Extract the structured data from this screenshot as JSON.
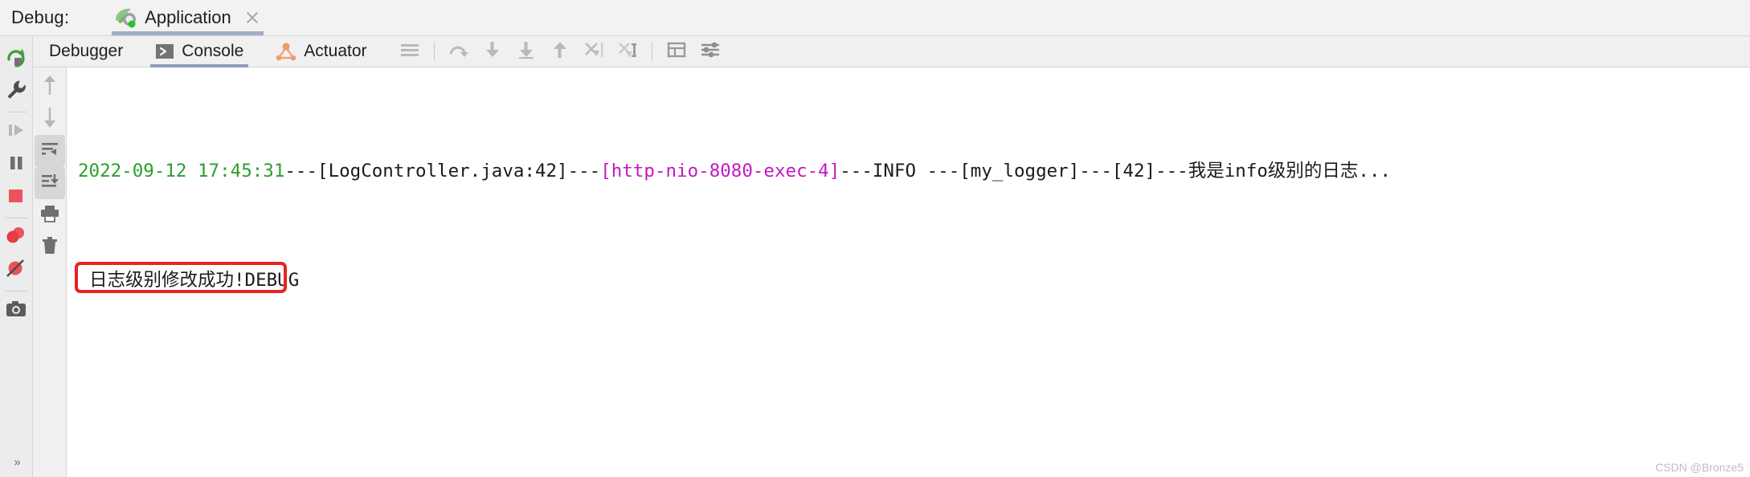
{
  "header": {
    "label": "Debug:",
    "run_tab": {
      "name": "Application",
      "icon": "spring-boot-leaf-icon",
      "close_icon": "close-icon",
      "selected": true
    }
  },
  "left_rail": {
    "buttons": [
      {
        "name": "rerun-button",
        "icon": "rerun-icon",
        "tooltip": "Rerun"
      },
      {
        "name": "edit-configurations-button",
        "icon": "wrench-icon",
        "tooltip": "Edit Configurations"
      },
      {
        "name": "resume-program-button",
        "icon": "resume-icon",
        "tooltip": "Resume Program"
      },
      {
        "name": "pause-program-button",
        "icon": "pause-icon",
        "tooltip": "Pause Program"
      },
      {
        "name": "stop-button",
        "icon": "stop-square-icon",
        "tooltip": "Stop"
      },
      {
        "name": "view-breakpoints-button",
        "icon": "breakpoints-icon",
        "tooltip": "View Breakpoints"
      },
      {
        "name": "mute-breakpoints-button",
        "icon": "mute-breakpoints-icon",
        "tooltip": "Mute Breakpoints"
      },
      {
        "name": "screenshot-button",
        "icon": "camera-icon",
        "tooltip": "Screenshot"
      }
    ],
    "expand_label": "»"
  },
  "tabbar": {
    "tabs": [
      {
        "name": "tab-debugger",
        "label": "Debugger",
        "icon": null,
        "selected": false
      },
      {
        "name": "tab-console",
        "label": "Console",
        "icon": "console-chevron-icon",
        "selected": true
      },
      {
        "name": "tab-actuator",
        "label": "Actuator",
        "icon": "actuator-graph-icon",
        "selected": false
      }
    ],
    "toolbar": [
      {
        "name": "layout-settings-button",
        "icon": "hamburger-icon"
      },
      {
        "name": "step-over-button",
        "icon": "step-over-icon"
      },
      {
        "name": "step-into-button",
        "icon": "step-into-icon"
      },
      {
        "name": "force-step-into-button",
        "icon": "force-step-into-icon"
      },
      {
        "name": "step-out-button",
        "icon": "step-out-icon"
      },
      {
        "name": "run-to-cursor-button",
        "icon": "run-to-cursor-icon"
      },
      {
        "name": "evaluate-expression-button",
        "icon": "evaluate-expression-icon"
      },
      {
        "name": "show-execution-point-button",
        "icon": "frames-icon"
      },
      {
        "name": "settings-button",
        "icon": "sliders-icon"
      }
    ]
  },
  "console_gutter": {
    "buttons": [
      {
        "name": "scroll-up-button",
        "icon": "arrow-up-icon"
      },
      {
        "name": "scroll-down-button",
        "icon": "arrow-down-icon"
      },
      {
        "name": "soft-wrap-button",
        "icon": "soft-wrap-icon",
        "active": true
      },
      {
        "name": "scroll-to-end-button",
        "icon": "scroll-to-end-icon",
        "active": true
      },
      {
        "name": "print-button",
        "icon": "printer-icon"
      },
      {
        "name": "clear-all-button",
        "icon": "trash-icon"
      }
    ]
  },
  "console": {
    "lines": [
      {
        "name": "console-log-line-info",
        "segments": [
          {
            "text": "2022-09-12 17:45:31",
            "color": "#2e9e2e",
            "class": "c-green"
          },
          {
            "text": "---[LogController.java:42]---",
            "color": "#1b1b1b",
            "class": "c-plain"
          },
          {
            "text": "[http-nio-8080-exec-4]",
            "color": "#c418c4",
            "class": "c-magenta"
          },
          {
            "text": "---INFO ---[my_logger]---[42]---我是info级别的日志...",
            "color": "#1b1b1b",
            "class": "c-plain"
          }
        ]
      },
      {
        "name": "console-log-line-debug",
        "highlighted": true,
        "highlight_color": "#e8251b",
        "segments": [
          {
            "text": "日志级别修改成功!DEBUG",
            "color": "#1b1b1b",
            "class": "c-plain"
          }
        ]
      }
    ]
  },
  "watermark": "CSDN @Bronze5",
  "colors": {
    "timestamp_green": "#2e9e2e",
    "thread_magenta": "#c418c4",
    "highlight_red": "#e8251b",
    "tab_selected_underline": "#8f9fba",
    "run_tab_underline": "#a0aec4",
    "background": "#f2f2f2",
    "console_background": "#ffffff"
  }
}
